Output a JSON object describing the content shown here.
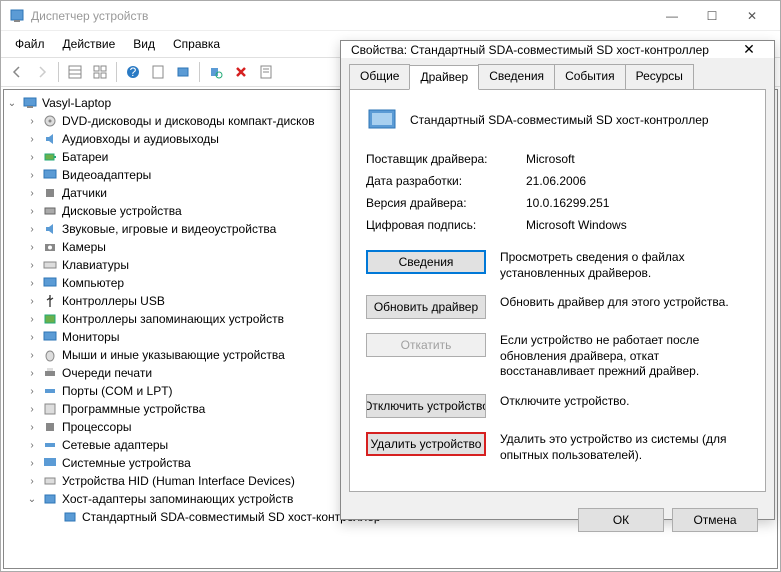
{
  "window": {
    "title": "Диспетчер устройств"
  },
  "menu": {
    "file": "Файл",
    "action": "Действие",
    "view": "Вид",
    "help": "Справка"
  },
  "tree": {
    "root": "Vasyl-Laptop",
    "items": [
      "DVD-дисководы и дисководы компакт-дисков",
      "Аудиовходы и аудиовыходы",
      "Батареи",
      "Видеоадаптеры",
      "Датчики",
      "Дисковые устройства",
      "Звуковые, игровые и видеоустройства",
      "Камеры",
      "Клавиатуры",
      "Компьютер",
      "Контроллеры USB",
      "Контроллеры запоминающих устройств",
      "Мониторы",
      "Мыши и иные указывающие устройства",
      "Очереди печати",
      "Порты (COM и LPT)",
      "Программные устройства",
      "Процессоры",
      "Сетевые адаптеры",
      "Системные устройства",
      "Устройства HID (Human Interface Devices)",
      "Хост-адаптеры запоминающих устройств"
    ],
    "child": "Стандартный SDA-совместимый SD хост-контроллер"
  },
  "dialog": {
    "title": "Свойства: Стандартный SDA-совместимый SD хост-контроллер",
    "tabs": {
      "general": "Общие",
      "driver": "Драйвер",
      "details": "Сведения",
      "events": "События",
      "resources": "Ресурсы"
    },
    "device_name": "Стандартный SDA-совместимый SD хост-контроллер",
    "rows": {
      "provider_lbl": "Поставщик драйвера:",
      "provider_val": "Microsoft",
      "date_lbl": "Дата разработки:",
      "date_val": "21.06.2006",
      "version_lbl": "Версия драйвера:",
      "version_val": "10.0.16299.251",
      "sig_lbl": "Цифровая подпись:",
      "sig_val": "Microsoft Windows"
    },
    "buttons": {
      "details": "Сведения",
      "details_desc": "Просмотреть сведения о файлах установленных драйверов.",
      "update": "Обновить драйвер",
      "update_desc": "Обновить драйвер для этого устройства.",
      "rollback": "Откатить",
      "rollback_desc": "Если устройство не работает после обновления драйвера, откат восстанавливает прежний драйвер.",
      "disable": "Отключить устройство",
      "disable_desc": "Отключите устройство.",
      "uninstall": "Удалить устройство",
      "uninstall_desc": "Удалить это устройство из системы (для опытных пользователей)."
    },
    "ok": "ОК",
    "cancel": "Отмена"
  }
}
